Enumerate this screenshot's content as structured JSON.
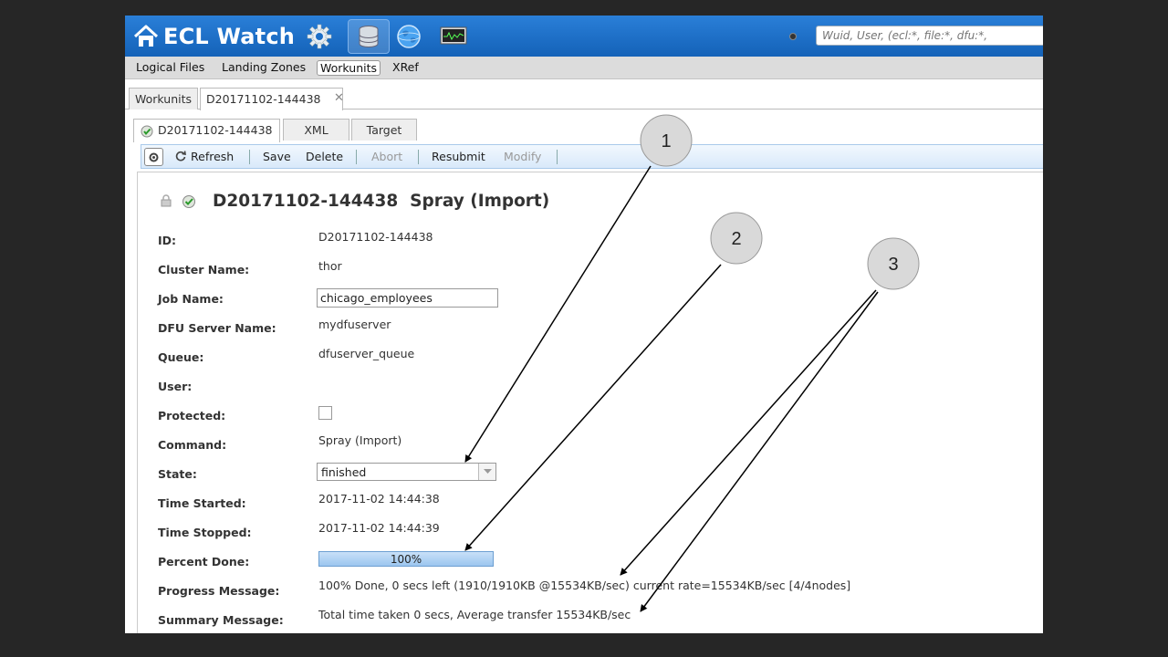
{
  "app": {
    "title": "ECL Watch"
  },
  "topbar": {
    "icons": [
      "home-icon",
      "gear-icon",
      "database-icon",
      "globe-icon",
      "monitor-icon"
    ],
    "search_placeholder": "Wuid, User, (ecl:*, file:*, dfu:*,"
  },
  "menu": {
    "items": [
      "Logical Files",
      "Landing Zones",
      "Workunits",
      "XRef"
    ],
    "active": "Workunits"
  },
  "outer_tabs": [
    "Workunits",
    "D20171102-144438"
  ],
  "inner_tabs": [
    "D20171102-144438",
    "XML",
    "Target"
  ],
  "toolbar": {
    "refresh": "Refresh",
    "save": "Save",
    "delete": "Delete",
    "abort": "Abort",
    "resubmit": "Resubmit",
    "modify": "Modify"
  },
  "workunit": {
    "title": "D20171102-144438  Spray (Import)",
    "labels": {
      "id": "ID:",
      "cluster": "Cluster Name:",
      "job": "Job Name:",
      "dfu_server": "DFU Server Name:",
      "queue": "Queue:",
      "user": "User:",
      "protected": "Protected:",
      "command": "Command:",
      "state": "State:",
      "time_started": "Time Started:",
      "time_stopped": "Time Stopped:",
      "percent_done": "Percent Done:",
      "progress_message": "Progress Message:",
      "summary_message": "Summary Message:"
    },
    "values": {
      "id": "D20171102-144438",
      "cluster": "thor",
      "job": "chicago_employees",
      "dfu_server": "mydfuserver",
      "queue": "dfuserver_queue",
      "user": "",
      "protected": false,
      "command": "Spray (Import)",
      "state": "finished",
      "time_started": "2017-11-02 14:44:38",
      "time_stopped": "2017-11-02 14:44:39",
      "percent_done_text": "100%",
      "percent_done": 100,
      "progress_message": "100% Done, 0 secs left (1910/1910KB @15534KB/sec) current rate=15534KB/sec [4/4nodes]",
      "summary_message": "Total time taken 0 secs, Average transfer 15534KB/sec"
    }
  },
  "callouts": [
    "1",
    "2",
    "3"
  ],
  "colors": {
    "topbar": "#1c6ec7",
    "menubar": "#dcdcdc",
    "toolbar": "#d9e9fa",
    "progress": "#9cc6ef"
  }
}
